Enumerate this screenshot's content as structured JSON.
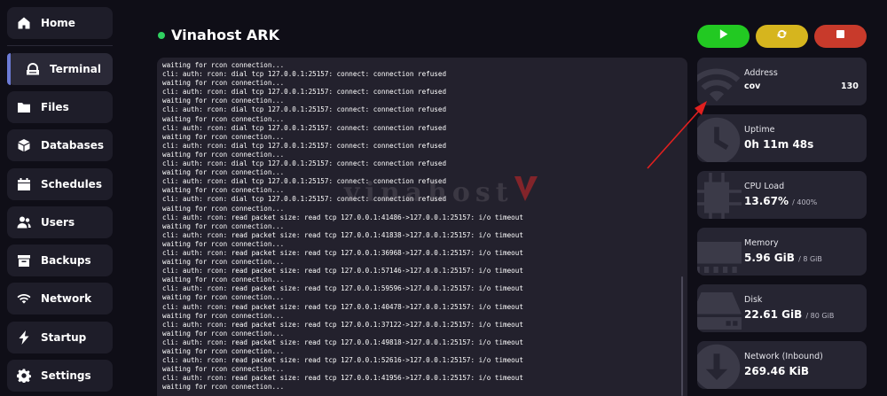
{
  "sidebar": {
    "items": [
      {
        "label": "Home",
        "icon": "home-icon"
      },
      {
        "label": "Terminal",
        "icon": "terminal-icon"
      },
      {
        "label": "Files",
        "icon": "folder-icon"
      },
      {
        "label": "Databases",
        "icon": "database-icon"
      },
      {
        "label": "Schedules",
        "icon": "calendar-icon"
      },
      {
        "label": "Users",
        "icon": "users-icon"
      },
      {
        "label": "Backups",
        "icon": "archive-icon"
      },
      {
        "label": "Network",
        "icon": "wifi-icon"
      },
      {
        "label": "Startup",
        "icon": "bolt-icon"
      },
      {
        "label": "Settings",
        "icon": "gear-icon"
      }
    ],
    "active": "Terminal"
  },
  "server": {
    "name": "Vinahost ARK",
    "status_color": "#2fd060"
  },
  "power_controls": {
    "start_icon": "play-icon",
    "restart_icon": "refresh-icon",
    "stop_icon": "stop-icon",
    "colors": {
      "start": "#22c922",
      "restart": "#d6b51e",
      "stop": "#c83a2b"
    }
  },
  "console": {
    "lines": [
      "waiting for rcon connection...",
      "cli: auth: rcon: dial tcp 127.0.0.1:25157: connect: connection refused",
      "waiting for rcon connection...",
      "cli: auth: rcon: dial tcp 127.0.0.1:25157: connect: connection refused",
      "waiting for rcon connection...",
      "cli: auth: rcon: dial tcp 127.0.0.1:25157: connect: connection refused",
      "waiting for rcon connection...",
      "cli: auth: rcon: dial tcp 127.0.0.1:25157: connect: connection refused",
      "waiting for rcon connection...",
      "cli: auth: rcon: dial tcp 127.0.0.1:25157: connect: connection refused",
      "waiting for rcon connection...",
      "cli: auth: rcon: dial tcp 127.0.0.1:25157: connect: connection refused",
      "waiting for rcon connection...",
      "cli: auth: rcon: dial tcp 127.0.0.1:25157: connect: connection refused",
      "waiting for rcon connection...",
      "cli: auth: rcon: dial tcp 127.0.0.1:25157: connect: connection refused",
      "waiting for rcon connection...",
      "cli: auth: rcon: read packet size: read tcp 127.0.0.1:41486->127.0.0.1:25157: i/o timeout",
      "waiting for rcon connection...",
      "cli: auth: rcon: read packet size: read tcp 127.0.0.1:41838->127.0.0.1:25157: i/o timeout",
      "waiting for rcon connection...",
      "cli: auth: rcon: read packet size: read tcp 127.0.0.1:36968->127.0.0.1:25157: i/o timeout",
      "waiting for rcon connection...",
      "cli: auth: rcon: read packet size: read tcp 127.0.0.1:57146->127.0.0.1:25157: i/o timeout",
      "waiting for rcon connection...",
      "cli: auth: rcon: read packet size: read tcp 127.0.0.1:59596->127.0.0.1:25157: i/o timeout",
      "waiting for rcon connection...",
      "cli: auth: rcon: read packet size: read tcp 127.0.0.1:40478->127.0.0.1:25157: i/o timeout",
      "waiting for rcon connection...",
      "cli: auth: rcon: read packet size: read tcp 127.0.0.1:37122->127.0.0.1:25157: i/o timeout",
      "waiting for rcon connection...",
      "cli: auth: rcon: read packet size: read tcp 127.0.0.1:49818->127.0.0.1:25157: i/o timeout",
      "waiting for rcon connection...",
      "cli: auth: rcon: read packet size: read tcp 127.0.0.1:52616->127.0.0.1:25157: i/o timeout",
      "waiting for rcon connection...",
      "cli: auth: rcon: read packet size: read tcp 127.0.0.1:41956->127.0.0.1:25157: i/o timeout",
      "waiting for rcon connection..."
    ]
  },
  "watermark": {
    "text": "vinahost"
  },
  "stats": {
    "address": {
      "label": "Address",
      "value": "cov",
      "port": "130",
      "icon": "wifi-icon"
    },
    "uptime": {
      "label": "Uptime",
      "value": "0h 11m 48s",
      "icon": "clock-icon"
    },
    "cpu": {
      "label": "CPU Load",
      "value": "13.67%",
      "unit": "/ 400%",
      "icon": "cpu-icon"
    },
    "memory": {
      "label": "Memory",
      "value": "5.96 GiB",
      "unit": "/ 8 GiB",
      "icon": "memory-icon"
    },
    "disk": {
      "label": "Disk",
      "value": "22.61 GiB",
      "unit": "/ 80 GiB",
      "icon": "hdd-icon"
    },
    "network": {
      "label": "Network (Inbound)",
      "value": "269.46 KiB",
      "icon": "download-icon"
    }
  },
  "annotation": {
    "arrow_color": "#e0201f"
  }
}
